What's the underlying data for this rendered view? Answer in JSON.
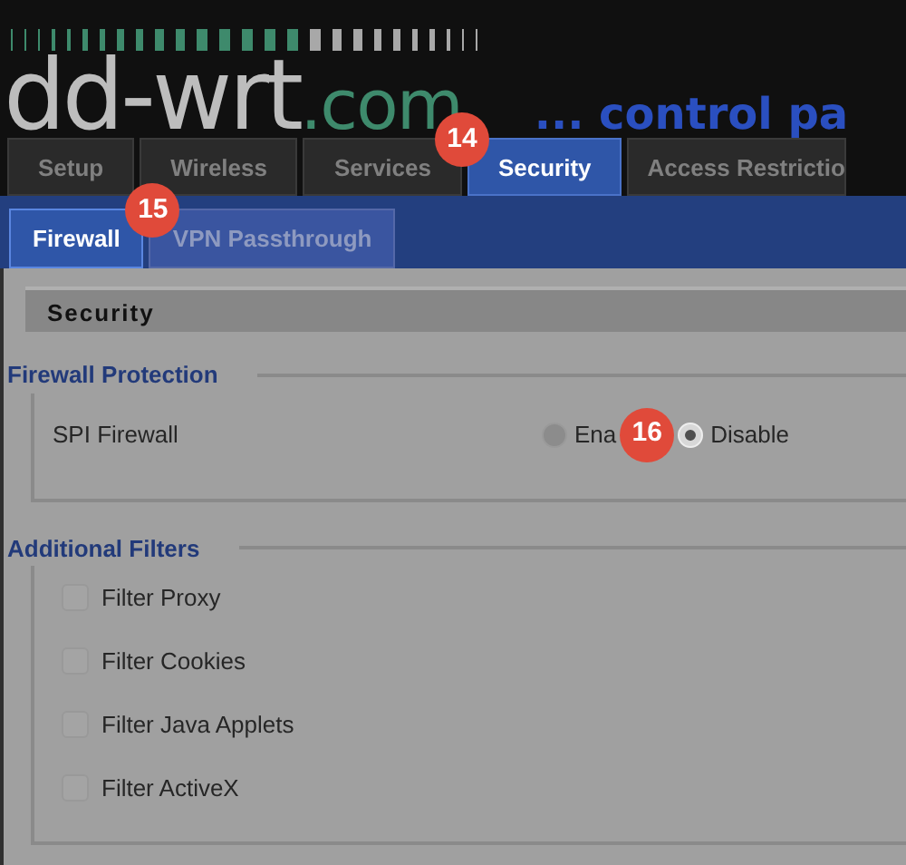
{
  "logo": {
    "name": "dd-wrt",
    "domain": ".com",
    "tagline": "... control pa"
  },
  "tabs": [
    {
      "label": "Setup",
      "selected": false
    },
    {
      "label": "Wireless",
      "selected": false
    },
    {
      "label": "Services",
      "selected": false
    },
    {
      "label": "Security",
      "selected": true
    },
    {
      "label": "Access Restrictio",
      "selected": false
    }
  ],
  "subtabs": [
    {
      "label": "Firewall",
      "selected": true
    },
    {
      "label": "VPN Passthrough",
      "selected": false
    }
  ],
  "section_title": "Security",
  "firewall_protection": {
    "legend": "Firewall Protection",
    "label": "SPI Firewall",
    "options": [
      {
        "label": "Ena",
        "selected": false
      },
      {
        "label": "Disable",
        "selected": true
      }
    ]
  },
  "additional_filters": {
    "legend": "Additional Filters",
    "items": [
      {
        "label": "Filter Proxy",
        "checked": false
      },
      {
        "label": "Filter Cookies",
        "checked": false
      },
      {
        "label": "Filter Java Applets",
        "checked": false
      },
      {
        "label": "Filter ActiveX",
        "checked": false
      }
    ]
  },
  "step_markers": [
    {
      "label": "14",
      "kind": "tab"
    },
    {
      "label": "15",
      "kind": "subtab"
    },
    {
      "label": "16",
      "kind": "radio"
    }
  ]
}
